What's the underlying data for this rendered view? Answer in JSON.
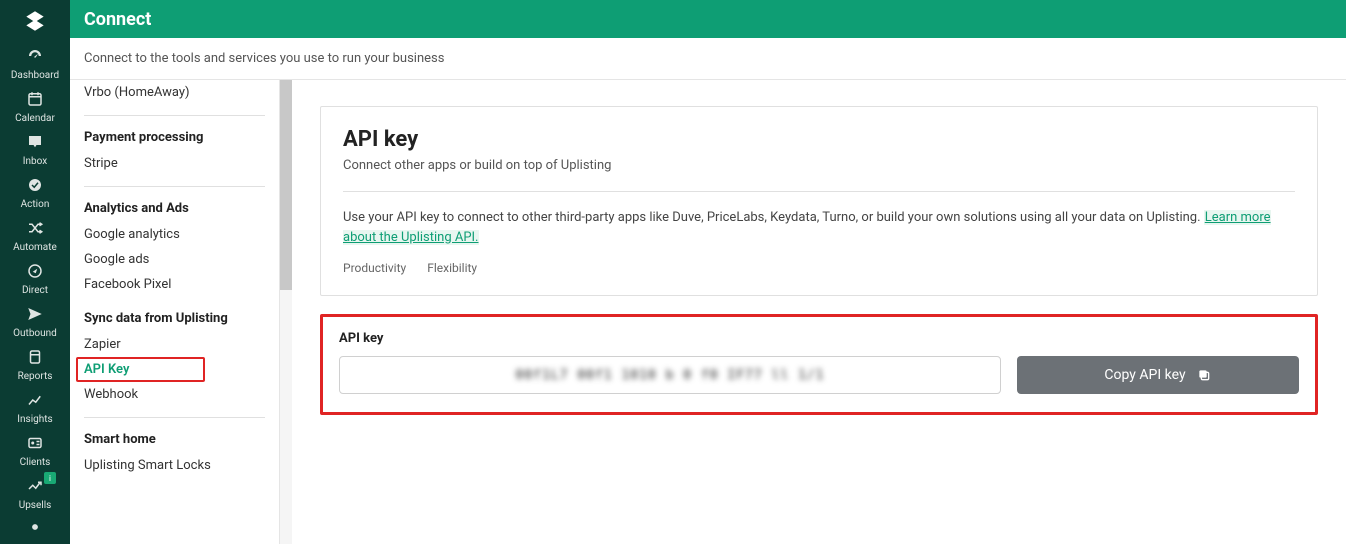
{
  "nav": {
    "items": [
      {
        "label": "Dashboard"
      },
      {
        "label": "Calendar"
      },
      {
        "label": "Inbox"
      },
      {
        "label": "Action"
      },
      {
        "label": "Automate"
      },
      {
        "label": "Direct"
      },
      {
        "label": "Outbound"
      },
      {
        "label": "Reports"
      },
      {
        "label": "Insights"
      },
      {
        "label": "Clients"
      },
      {
        "label": "Upsells",
        "badge": "i"
      }
    ]
  },
  "header": {
    "title": "Connect",
    "subtitle": "Connect to the tools and services you use to run your business"
  },
  "side": {
    "top_item": "Vrbo (HomeAway)",
    "groups": [
      {
        "title": "Payment processing",
        "items": [
          "Stripe"
        ]
      },
      {
        "title": "Analytics and Ads",
        "items": [
          "Google analytics",
          "Google ads",
          "Facebook Pixel"
        ]
      },
      {
        "title": "Sync data from Uplisting",
        "items": [
          "Zapier",
          "API Key",
          "Webhook"
        ],
        "active": "API Key"
      },
      {
        "title": "Smart home",
        "items": [
          "Uplisting Smart Locks"
        ]
      }
    ]
  },
  "card": {
    "title": "API key",
    "sub": "Connect other apps or build on top of Uplisting",
    "desc_pre": "Use your API key to connect to other third-party apps like Duve, PriceLabs, Keydata, Turno, or build your own solutions using all your data on Uplisting. ",
    "desc_link": "Learn more about the Uplisting API.",
    "tags": [
      "Productivity",
      "Flexibility"
    ]
  },
  "keybox": {
    "label": "API key",
    "masked": "00f1L7 00f1 1010 b 0 f0 IF77 ll 1/1",
    "copy": "Copy API key"
  }
}
